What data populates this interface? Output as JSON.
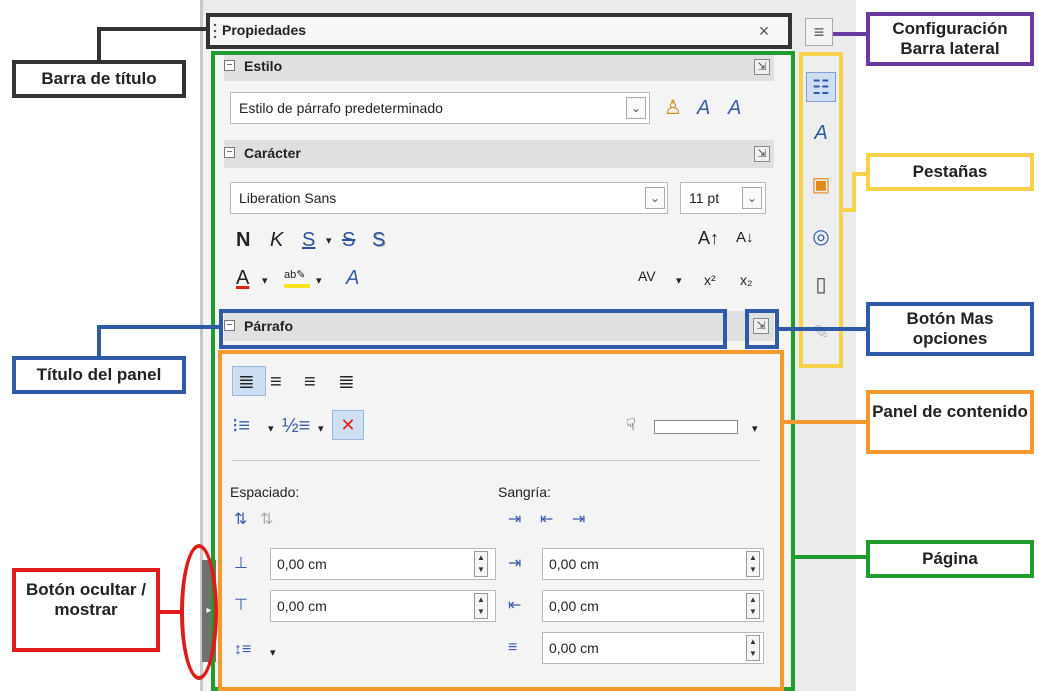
{
  "sidebar": {
    "title": "Propiedades",
    "close_glyph": "×",
    "menu_glyph": "≡",
    "hide_show_glyph": "▸",
    "sections": {
      "estilo": {
        "title": "Estilo",
        "paragraph_style": "Estilo de párrafo predeterminado"
      },
      "caracter": {
        "title": "Carácter",
        "font_name": "Liberation Sans",
        "font_size": "11 pt",
        "bold": "N",
        "italic": "K",
        "underline": "S",
        "strike": "S",
        "shadow": "S",
        "superscript": "x²",
        "subscript": "x₂",
        "spacing": "AV"
      },
      "parrafo": {
        "title": "Párrafo",
        "espaciado_label": "Espaciado:",
        "sangria_label": "Sangría:",
        "above_spacing": "0,00 cm",
        "below_spacing": "0,00 cm",
        "before_indent": "0,00 cm",
        "after_indent": "0,00 cm",
        "first_line_indent": "0,00 cm"
      }
    },
    "tabs": [
      "properties-tab",
      "styles-tab",
      "gallery-tab",
      "navigator-tab",
      "page-tab",
      "style-inspector-tab"
    ]
  },
  "callouts": {
    "barra_titulo": "Barra de título",
    "config": "Configuración Barra lateral",
    "pestanas": "Pestañas",
    "boton_mas": "Botón Mas opciones",
    "titulo_panel": "Título del panel",
    "panel_contenido": "Panel de contenido",
    "pagina": "Página",
    "boton_ocultar": "Botón ocultar / mostrar"
  },
  "colors": {
    "title_bar_frame": "#333333",
    "page_frame": "#1e9c2e",
    "content_frame": "#f39a2e",
    "panel_title_frame": "#2e5aa8",
    "config_frame": "#6b3aa0",
    "tabs_frame": "#f5d24a",
    "hide_frame": "#e01b1b"
  }
}
